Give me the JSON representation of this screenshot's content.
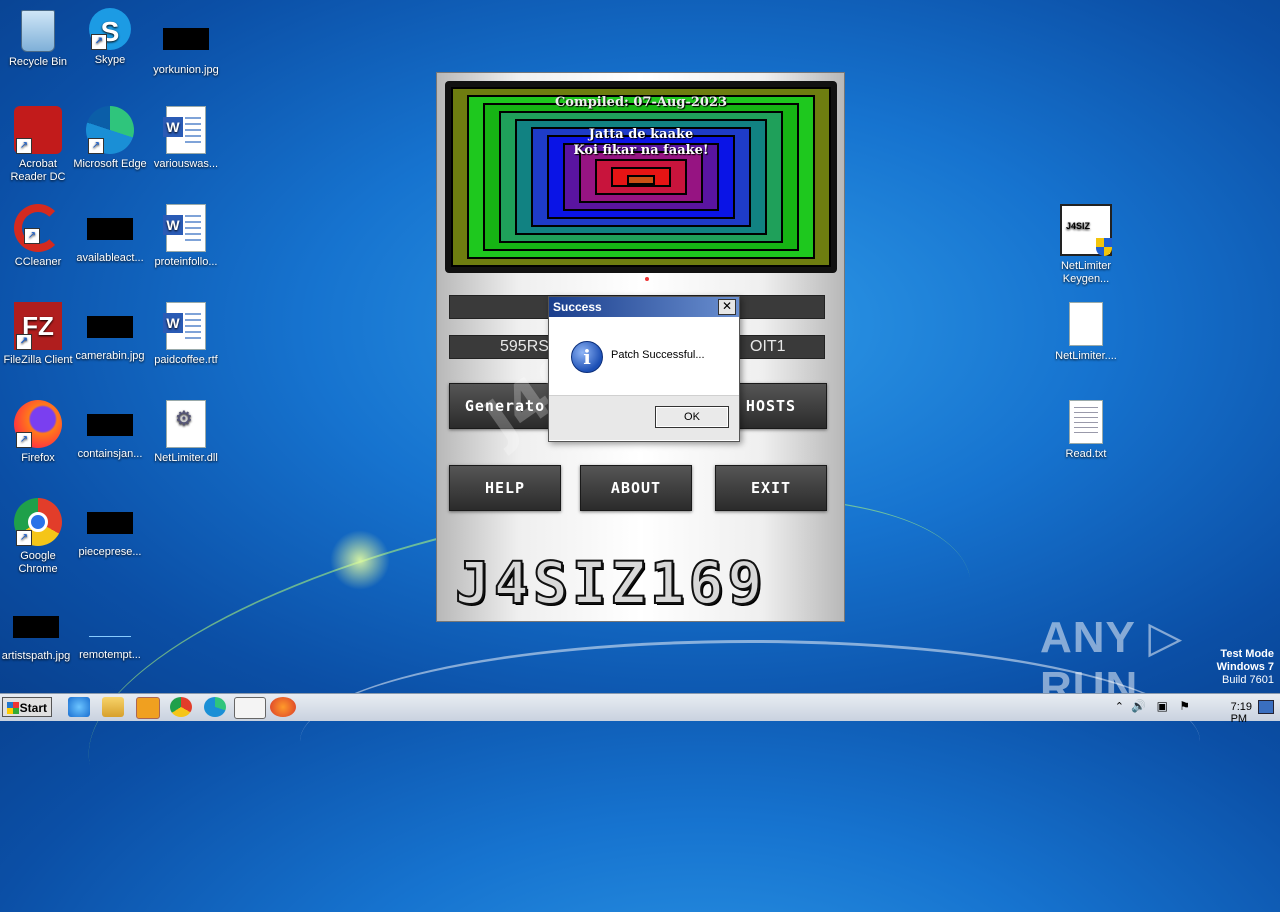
{
  "desktop": {
    "icons": [
      {
        "name": "recycle-bin",
        "label": "Recycle Bin"
      },
      {
        "name": "skype",
        "label": "Skype"
      },
      {
        "name": "yorkunion",
        "label": "yorkunion.jpg"
      },
      {
        "name": "acrobat",
        "label": "Acrobat Reader DC"
      },
      {
        "name": "edge",
        "label": "Microsoft Edge"
      },
      {
        "name": "variouswas",
        "label": "variouswas..."
      },
      {
        "name": "ccleaner",
        "label": "CCleaner"
      },
      {
        "name": "availableact",
        "label": "availableact..."
      },
      {
        "name": "proteinfollo",
        "label": "proteinfollo..."
      },
      {
        "name": "filezilla",
        "label": "FileZilla Client"
      },
      {
        "name": "camerabin",
        "label": "camerabin.jpg"
      },
      {
        "name": "paidcoffee",
        "label": "paidcoffee.rtf"
      },
      {
        "name": "firefox",
        "label": "Firefox"
      },
      {
        "name": "containsjan",
        "label": "containsjan..."
      },
      {
        "name": "netlimiter-dll",
        "label": "NetLimiter.dll"
      },
      {
        "name": "chrome",
        "label": "Google Chrome"
      },
      {
        "name": "piecepresе",
        "label": "piecepresе..."
      },
      {
        "name": "artistspath",
        "label": "artistspath.jpg"
      },
      {
        "name": "remotempt",
        "label": "remotempt..."
      },
      {
        "name": "netlimiter-keygen",
        "label": "NetLimiter Keygen..."
      },
      {
        "name": "netlimiter-file",
        "label": "NetLimiter...."
      },
      {
        "name": "read-txt",
        "label": "Read.txt"
      }
    ]
  },
  "app": {
    "compiled": "Compiled: 07-Aug-2023",
    "slogan1": "Jatta de kaake",
    "slogan2": "Koi fikar na faake!",
    "field1": "",
    "field2_left": "595RS",
    "field2_right": "OIT1",
    "btn_generate": "Generato",
    "btn_hosts": "HOSTS",
    "btn_help": "HELP",
    "btn_about": "ABOUT",
    "btn_exit": "EXIT",
    "logo": "J4SIZ169"
  },
  "dialog": {
    "title": "Success",
    "close": "✕",
    "icon": "i",
    "message": "Patch Successful...",
    "ok": "OK"
  },
  "watermark": {
    "anyrun": "ANY ▷ RUN",
    "test_mode": "Test Mode",
    "os": "Windows 7",
    "build": "Build 7601"
  },
  "taskbar": {
    "start": "Start",
    "clock": "7:19 PM"
  },
  "colors": {
    "tv_rings": [
      "#6e7d10",
      "#1ec81e",
      "#16b414",
      "#1fa05a",
      "#118282",
      "#1e3cc8",
      "#0a14e6",
      "#5a14a0",
      "#961482",
      "#c8143c",
      "#e61414",
      "#c85014"
    ]
  }
}
